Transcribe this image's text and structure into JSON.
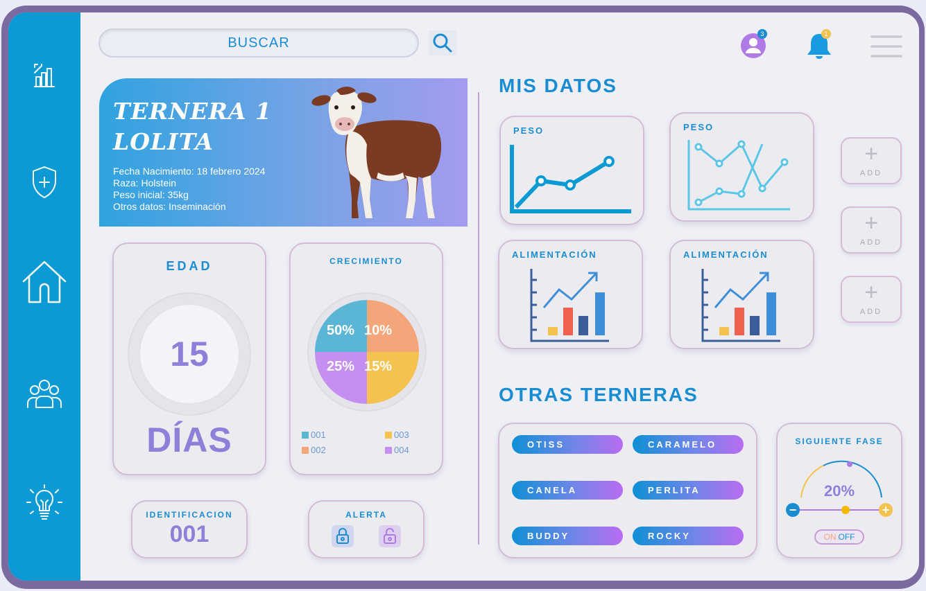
{
  "search": {
    "label": "BUSCAR"
  },
  "header": {
    "profile_badge": "3",
    "notification_badge": "1"
  },
  "sidebar": {
    "items": [
      {
        "name": "stats",
        "icon": "chart-icon"
      },
      {
        "name": "health",
        "icon": "shield-plus-icon"
      },
      {
        "name": "home",
        "icon": "home-icon"
      },
      {
        "name": "group",
        "icon": "users-icon"
      },
      {
        "name": "ideas",
        "icon": "lightbulb-icon"
      }
    ]
  },
  "profile": {
    "title_line1": "TERNERA 1",
    "title_line2": "LOLITA",
    "birth": "Fecha Nacimiento: 18 febrero 2024",
    "breed": "Raza: Holstein",
    "weight": "Peso inicial: 35kg",
    "other": "Otros datos: Inseminación"
  },
  "age": {
    "title": "EDAD",
    "value": "15",
    "unit": "DÍAS"
  },
  "growth": {
    "title": "CRECIMIENTO",
    "slices": [
      {
        "label": "50%",
        "color": "#5bb5d5"
      },
      {
        "label": "10%",
        "color": "#f5a57a"
      },
      {
        "label": "25%",
        "color": "#c48ff0"
      },
      {
        "label": "15%",
        "color": "#f5c24f"
      }
    ],
    "legend": [
      {
        "label": "001",
        "color": "#5bb5d5"
      },
      {
        "label": "003",
        "color": "#f5c24f"
      },
      {
        "label": "002",
        "color": "#f5a57a"
      },
      {
        "label": "004",
        "color": "#c48ff0"
      }
    ]
  },
  "identification": {
    "title": "IDENTIFICACION",
    "value": "001"
  },
  "alert": {
    "title": "ALERTA"
  },
  "my_data": {
    "title": "MIS DATOS",
    "cards": [
      {
        "title": "PESO"
      },
      {
        "title": "PESO"
      },
      {
        "title": "ALIMENTACIÓN"
      },
      {
        "title": "ALIMENTACIÓN"
      }
    ],
    "add_label": "ADD"
  },
  "others": {
    "title": "OTRAS TERNERAS",
    "names": [
      "OTISS",
      "CARAMELO",
      "CANELA",
      "PERLITA",
      "BUDDY",
      "ROCKY"
    ]
  },
  "next_phase": {
    "title": "SIGUIENTE FASE",
    "value": "20%",
    "on": "ON",
    "off": "OFF"
  },
  "colors": {
    "primary": "#0b9ad3",
    "accent": "#8f7fd9",
    "card_border": "#d4bcd6"
  }
}
